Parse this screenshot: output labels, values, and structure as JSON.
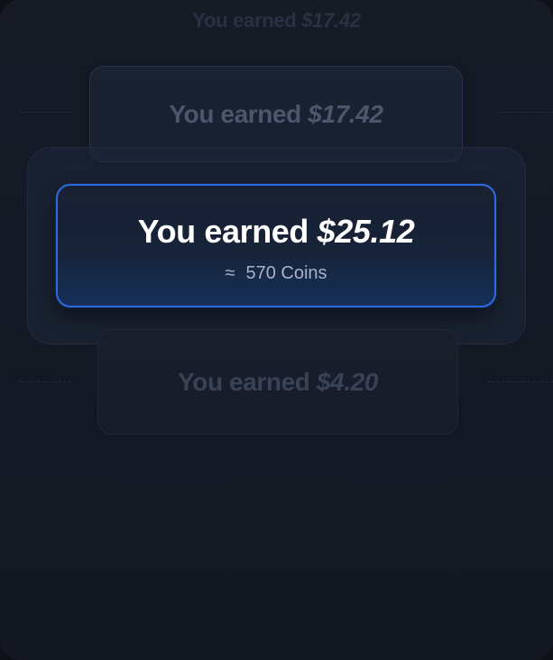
{
  "wheel": {
    "ghost_top": {
      "prefix": "You earned",
      "amount": "$17.42"
    },
    "previous": {
      "prefix": "You earned",
      "amount": "$17.42"
    },
    "selected": {
      "prefix": "You earned",
      "amount": "$25.12",
      "approx_symbol": "≈",
      "coins": "570 Coins"
    },
    "next": {
      "prefix": "You earned",
      "amount": "$4.20"
    }
  },
  "colors": {
    "background": "#141925",
    "accent_border": "#2c6be0",
    "primary_text": "#ffffff",
    "secondary_text": "#a9b2c6",
    "faded_text": "#4c566c"
  }
}
